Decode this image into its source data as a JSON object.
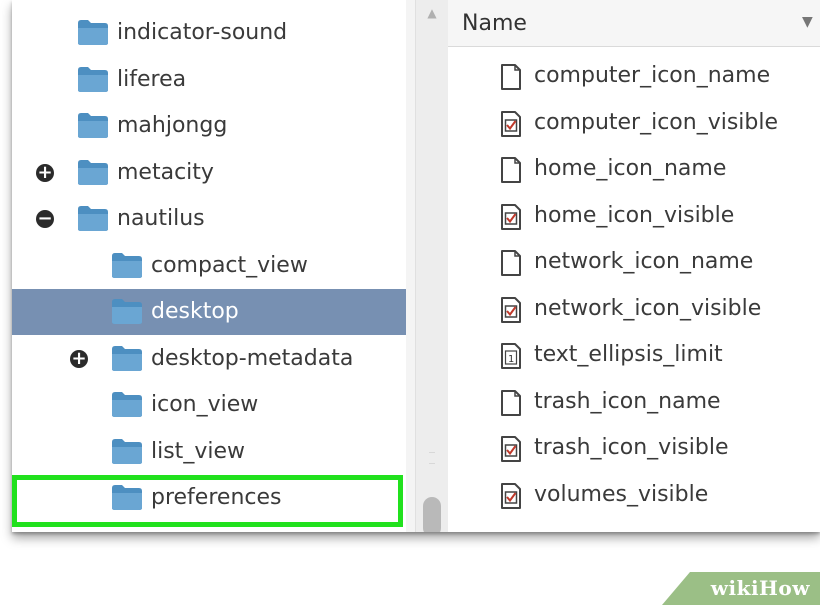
{
  "tree": {
    "items": [
      {
        "label": "indicator-sound",
        "level": 0,
        "expander": "",
        "state": "normal"
      },
      {
        "label": "liferea",
        "level": 0,
        "expander": "",
        "state": "normal"
      },
      {
        "label": "mahjongg",
        "level": 0,
        "expander": "",
        "state": "normal"
      },
      {
        "label": "metacity",
        "level": 0,
        "expander": "collapsed",
        "state": "normal"
      },
      {
        "label": "nautilus",
        "level": 0,
        "expander": "expanded",
        "state": "normal"
      },
      {
        "label": "compact_view",
        "level": 1,
        "expander": "",
        "state": "normal"
      },
      {
        "label": "desktop",
        "level": 1,
        "expander": "",
        "state": "selected"
      },
      {
        "label": "desktop-metadata",
        "level": 1,
        "expander": "collapsed",
        "state": "normal"
      },
      {
        "label": "icon_view",
        "level": 1,
        "expander": "",
        "state": "normal"
      },
      {
        "label": "list_view",
        "level": 1,
        "expander": "",
        "state": "normal"
      },
      {
        "label": "preferences",
        "level": 1,
        "expander": "",
        "state": "highlighted"
      }
    ]
  },
  "list": {
    "column_header": "Name",
    "items": [
      {
        "label": "computer_icon_name",
        "icon": "string-icon"
      },
      {
        "label": "computer_icon_visible",
        "icon": "checkbox-icon"
      },
      {
        "label": "home_icon_name",
        "icon": "string-icon"
      },
      {
        "label": "home_icon_visible",
        "icon": "checkbox-icon"
      },
      {
        "label": "network_icon_name",
        "icon": "string-icon"
      },
      {
        "label": "network_icon_visible",
        "icon": "checkbox-icon"
      },
      {
        "label": "text_ellipsis_limit",
        "icon": "integer-icon"
      },
      {
        "label": "trash_icon_name",
        "icon": "string-icon"
      },
      {
        "label": "trash_icon_visible",
        "icon": "checkbox-icon"
      },
      {
        "label": "volumes_visible",
        "icon": "checkbox-icon"
      }
    ]
  },
  "watermark": {
    "text": "wikiHow"
  },
  "colors": {
    "selection": "#7790b2",
    "highlight_border": "#21e11d",
    "folder": "#4d8fc1",
    "checkbox_mark": "#c0392b"
  }
}
